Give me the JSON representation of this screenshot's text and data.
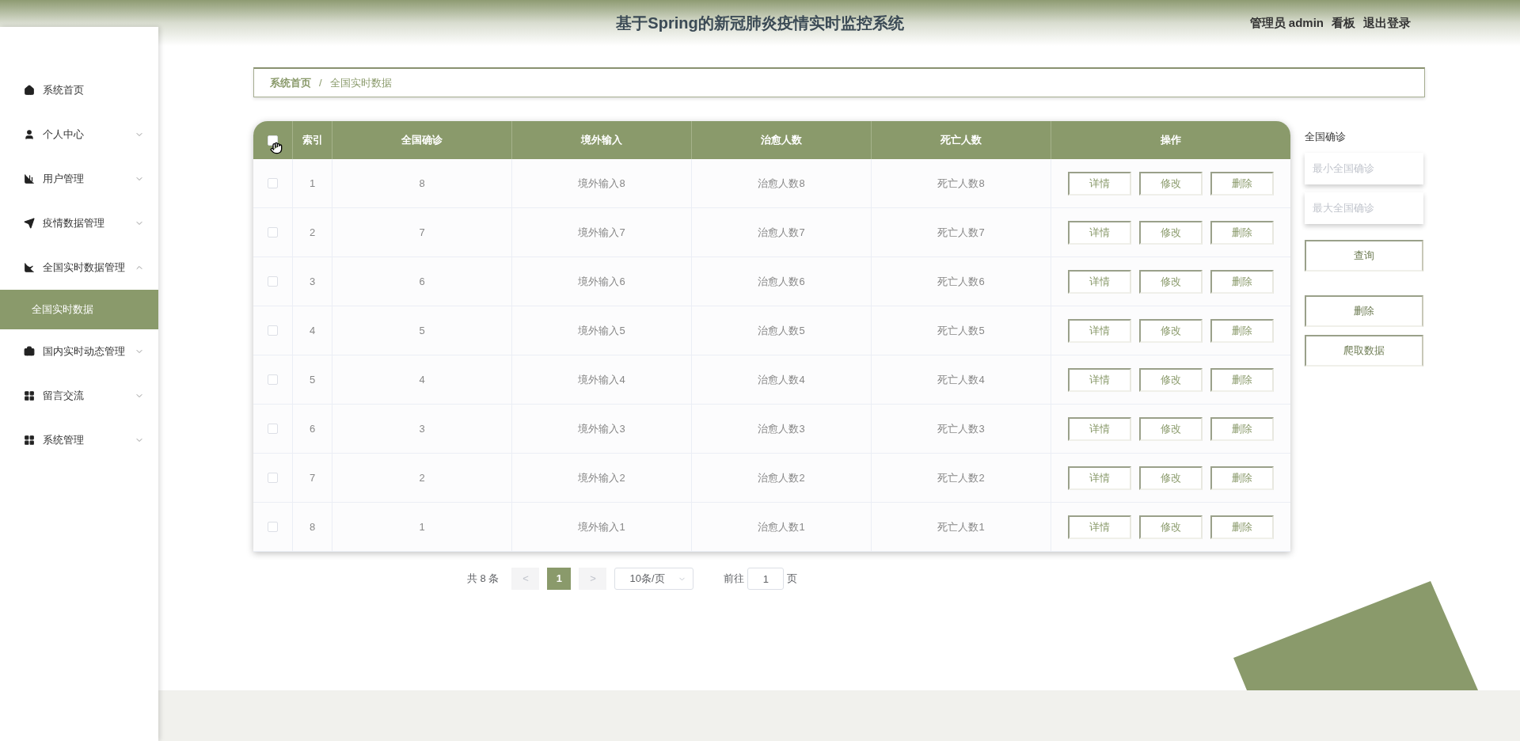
{
  "header": {
    "title": "基于Spring的新冠肺炎疫情实时监控系统",
    "links": [
      "管理员 admin",
      "看板",
      "退出登录"
    ]
  },
  "sidebar": {
    "items": [
      {
        "label": "系统首页",
        "kind": "link"
      },
      {
        "label": "个人中心",
        "kind": "menu",
        "expanded": false
      },
      {
        "label": "用户管理",
        "kind": "menu",
        "expanded": false
      },
      {
        "label": "疫情数据管理",
        "kind": "menu",
        "expanded": false
      },
      {
        "label": "全国实时数据管理",
        "kind": "menu",
        "expanded": true,
        "children": [
          {
            "label": "全国实时数据",
            "selected": true
          }
        ]
      },
      {
        "label": "国内实时动态管理",
        "kind": "menu",
        "expanded": false
      },
      {
        "label": "留言交流",
        "kind": "menu",
        "expanded": false
      },
      {
        "label": "系统管理",
        "kind": "menu",
        "expanded": false
      }
    ]
  },
  "breadcrumb": [
    "系统首页",
    "/",
    "全国实时数据"
  ],
  "table": {
    "select_all_checked": false,
    "columns": [
      "索引",
      "全国确诊",
      "境外输入",
      "治愈人数",
      "死亡人数",
      "操作"
    ],
    "rows": [
      {
        "checked": false,
        "cells": [
          "1",
          "8",
          "境外输入8",
          "治愈人数8",
          "死亡人数8"
        ],
        "actions": [
          "详情",
          "修改",
          "删除"
        ]
      },
      {
        "checked": false,
        "cells": [
          "2",
          "7",
          "境外输入7",
          "治愈人数7",
          "死亡人数7"
        ],
        "actions": [
          "详情",
          "修改",
          "删除"
        ]
      },
      {
        "checked": false,
        "cells": [
          "3",
          "6",
          "境外输入6",
          "治愈人数6",
          "死亡人数6"
        ],
        "actions": [
          "详情",
          "修改",
          "删除"
        ]
      },
      {
        "checked": false,
        "cells": [
          "4",
          "5",
          "境外输入5",
          "治愈人数5",
          "死亡人数5"
        ],
        "actions": [
          "详情",
          "修改",
          "删除"
        ]
      },
      {
        "checked": false,
        "cells": [
          "5",
          "4",
          "境外输入4",
          "治愈人数4",
          "死亡人数4"
        ],
        "actions": [
          "详情",
          "修改",
          "删除"
        ]
      },
      {
        "checked": false,
        "cells": [
          "6",
          "3",
          "境外输入3",
          "治愈人数3",
          "死亡人数3"
        ],
        "actions": [
          "详情",
          "修改",
          "删除"
        ]
      },
      {
        "checked": false,
        "cells": [
          "7",
          "2",
          "境外输入2",
          "治愈人数2",
          "死亡人数2"
        ],
        "actions": [
          "详情",
          "修改",
          "删除"
        ]
      },
      {
        "checked": false,
        "cells": [
          "8",
          "1",
          "境外输入1",
          "治愈人数1",
          "死亡人数1"
        ],
        "actions": [
          "详情",
          "修改",
          "删除"
        ]
      }
    ]
  },
  "pagination": {
    "total": "共 8 条",
    "prev": "<",
    "pages": [
      {
        "label": "1",
        "selected": true
      }
    ],
    "next": ">",
    "page_size": "10条/页",
    "goto_label": "前往",
    "goto_value": "1",
    "goto_suffix": "页"
  },
  "filter": {
    "label": "全国确诊",
    "min_placeholder": "最小全国确诊",
    "max_placeholder": "最大全国确诊",
    "search_button": "查询",
    "buttons": [
      "删除",
      "爬取数据"
    ]
  }
}
